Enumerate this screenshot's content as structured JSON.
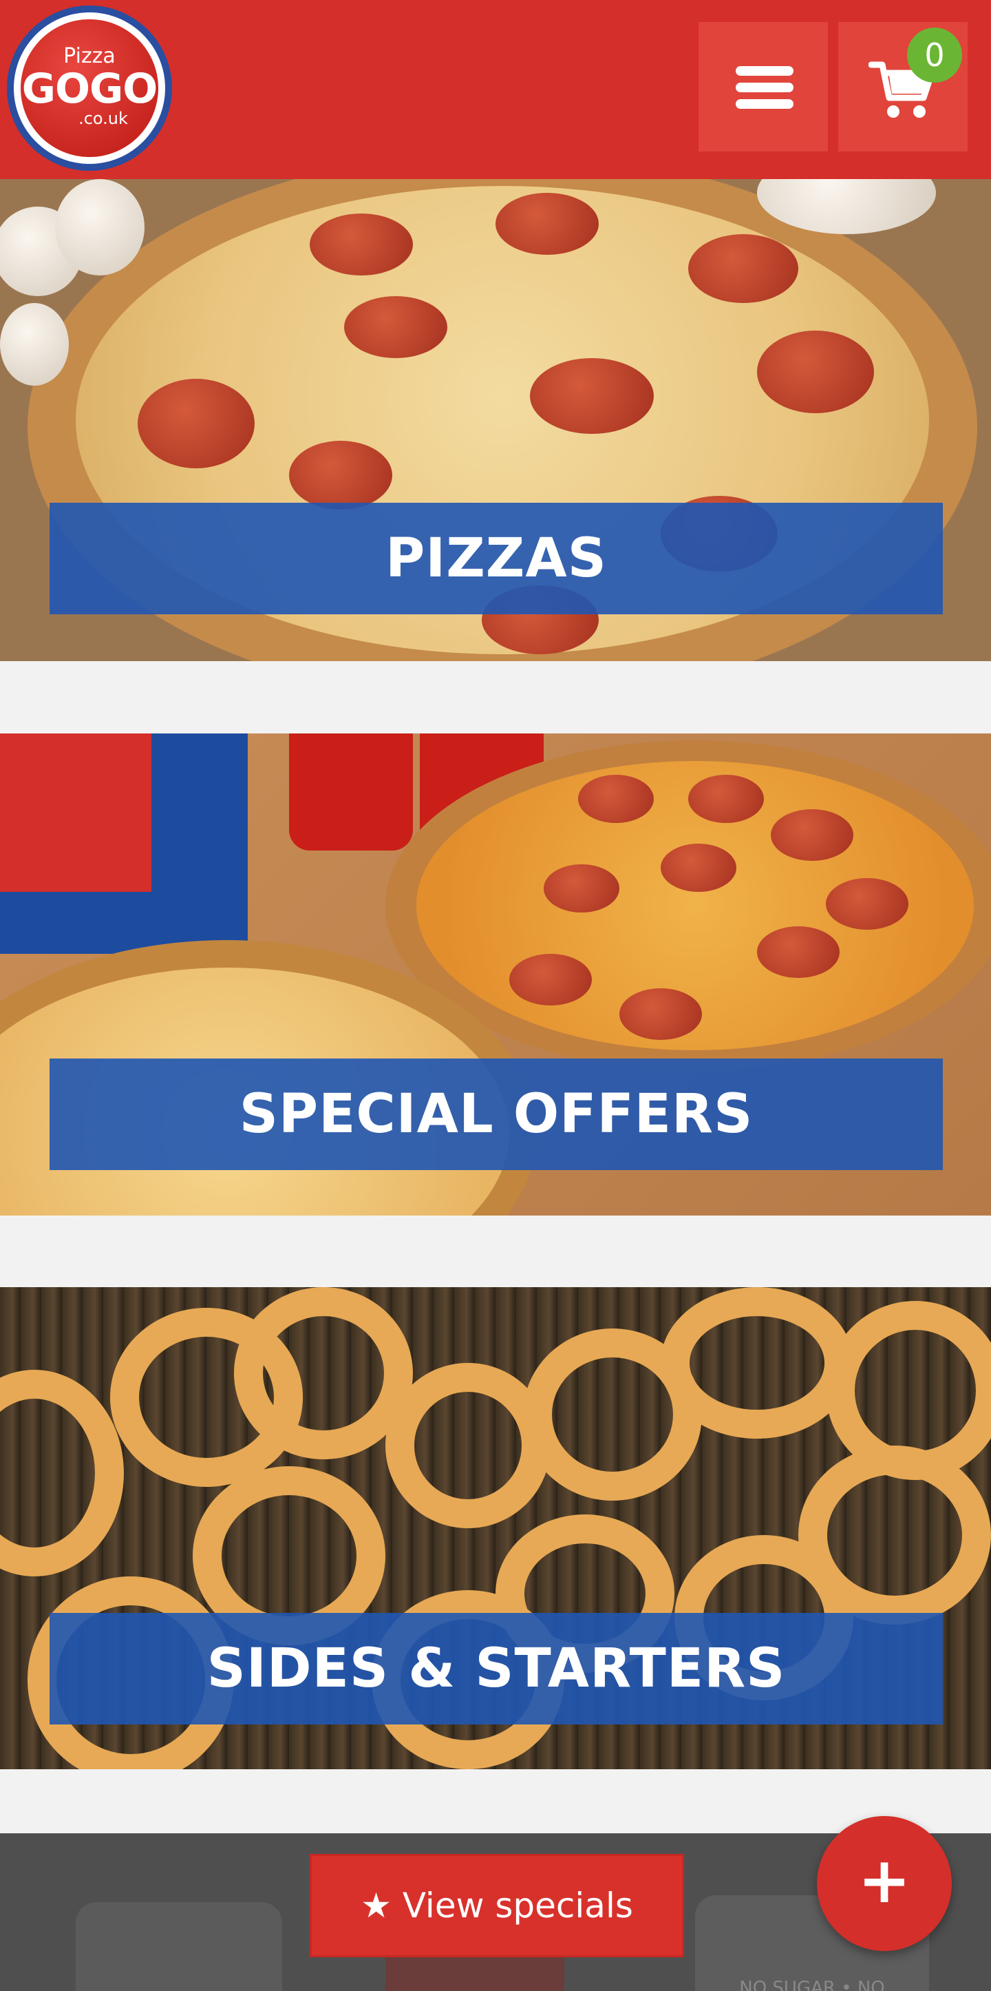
{
  "header": {
    "logo": {
      "line1": "Pizza",
      "line2": "GOGO",
      "line3": ".co.uk"
    },
    "menu_icon": "hamburger-menu-icon",
    "cart_icon": "shopping-cart-icon",
    "cart_count": "0"
  },
  "categories": [
    {
      "label": "PIZZAS",
      "image": "pizza-photo"
    },
    {
      "label": "SPECIAL OFFERS",
      "image": "pizza-deals-photo"
    },
    {
      "label": "SIDES & STARTERS",
      "image": "curly-fries-photo"
    }
  ],
  "bottom": {
    "view_specials": "★ View specials",
    "fab_label": "+",
    "ghost_text": "NO SUGAR • NO CALORIES"
  },
  "colors": {
    "brand_red": "#d42f2a",
    "label_blue": "#2056b2",
    "badge_green": "#6bb534",
    "bottom_bar": "#4f4f4f"
  }
}
